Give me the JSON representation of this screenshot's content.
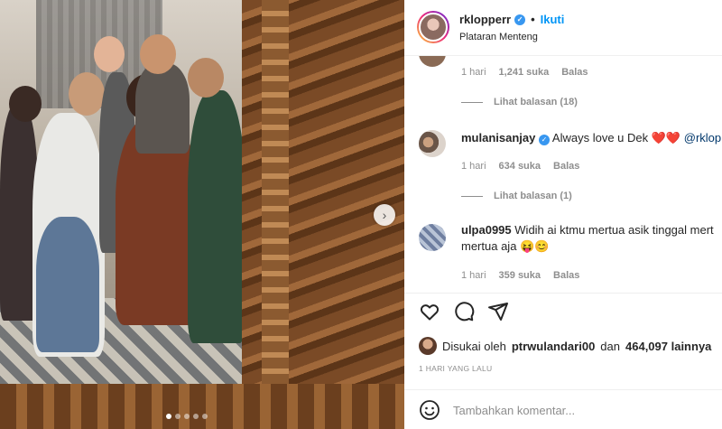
{
  "post": {
    "username": "rklopperr",
    "follow_label": "Ikuti",
    "separator": "•",
    "location": "Plataran Menteng",
    "carousel": {
      "slide_count": 5,
      "active_index": 0
    }
  },
  "comments": {
    "first_meta": {
      "time": "1 hari",
      "likes": "1,241 suka",
      "reply": "Balas"
    },
    "first_replies": "Lihat balasan (18)",
    "items": [
      {
        "username": "mulanisanjay",
        "text": "Always love u Dek",
        "emoji": "❤️❤️",
        "mention": "@rklop",
        "time": "1 hari",
        "likes": "634 suka",
        "reply": "Balas",
        "replies": "Lihat balasan (1)"
      },
      {
        "username": "ulpa0995",
        "text": "Widih ai ktmu mertua asik tinggal mert",
        "text2": "mertua aja",
        "emoji": "😝😊",
        "time": "1 hari",
        "likes": "359 suka",
        "reply": "Balas"
      }
    ]
  },
  "actions": {
    "liked_prefix": "Disukai oleh",
    "liked_user": "ptrwulandari00",
    "liked_and": "dan",
    "liked_count": "464,097 lainnya",
    "date": "1 HARI YANG LALU",
    "comment_placeholder": "Tambahkan komentar..."
  },
  "colors": {
    "link": "#0095f6",
    "muted": "#8e8e8e",
    "verified": "#3897f0"
  }
}
